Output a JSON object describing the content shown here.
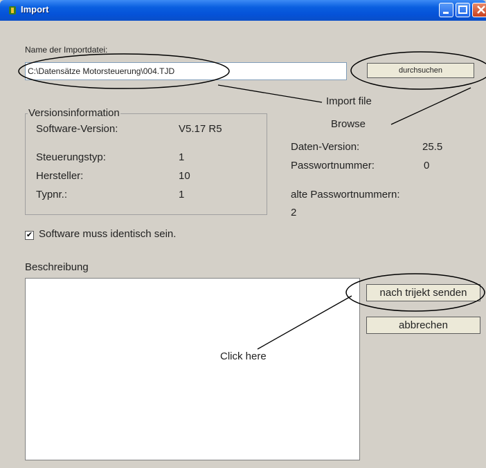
{
  "window": {
    "title": "Import",
    "icon": "app-icon"
  },
  "import_file": {
    "label": "Name der Importdatei:",
    "value": "C:\\Datensätze Motorsteuerung\\004.TJD",
    "browse_label": "durchsuchen"
  },
  "version_info": {
    "legend": "Versionsinformation",
    "rows": [
      {
        "label": "Software-Version:",
        "value": "V5.17 R5"
      },
      {
        "label": "Steuerungstyp:",
        "value": "1"
      },
      {
        "label": "Hersteller:",
        "value": "10"
      },
      {
        "label": "Typnr.:",
        "value": "1"
      }
    ]
  },
  "data_info": {
    "daten_version_label": "Daten-Version:",
    "daten_version_value": "25.5",
    "passwort_label": "Passwortnummer:",
    "passwort_value": "0",
    "alte_label": "alte Passwortnummern:",
    "alte_value": "2"
  },
  "checkbox": {
    "label": "Software muss identisch sein.",
    "checked": true,
    "mark": "✔"
  },
  "description": {
    "label": "Beschreibung",
    "value": ""
  },
  "buttons": {
    "send": "nach trijekt senden",
    "cancel": "abbrechen"
  },
  "annotations": {
    "import_file": "Import file",
    "browse": "Browse",
    "click_here": "Click here"
  }
}
